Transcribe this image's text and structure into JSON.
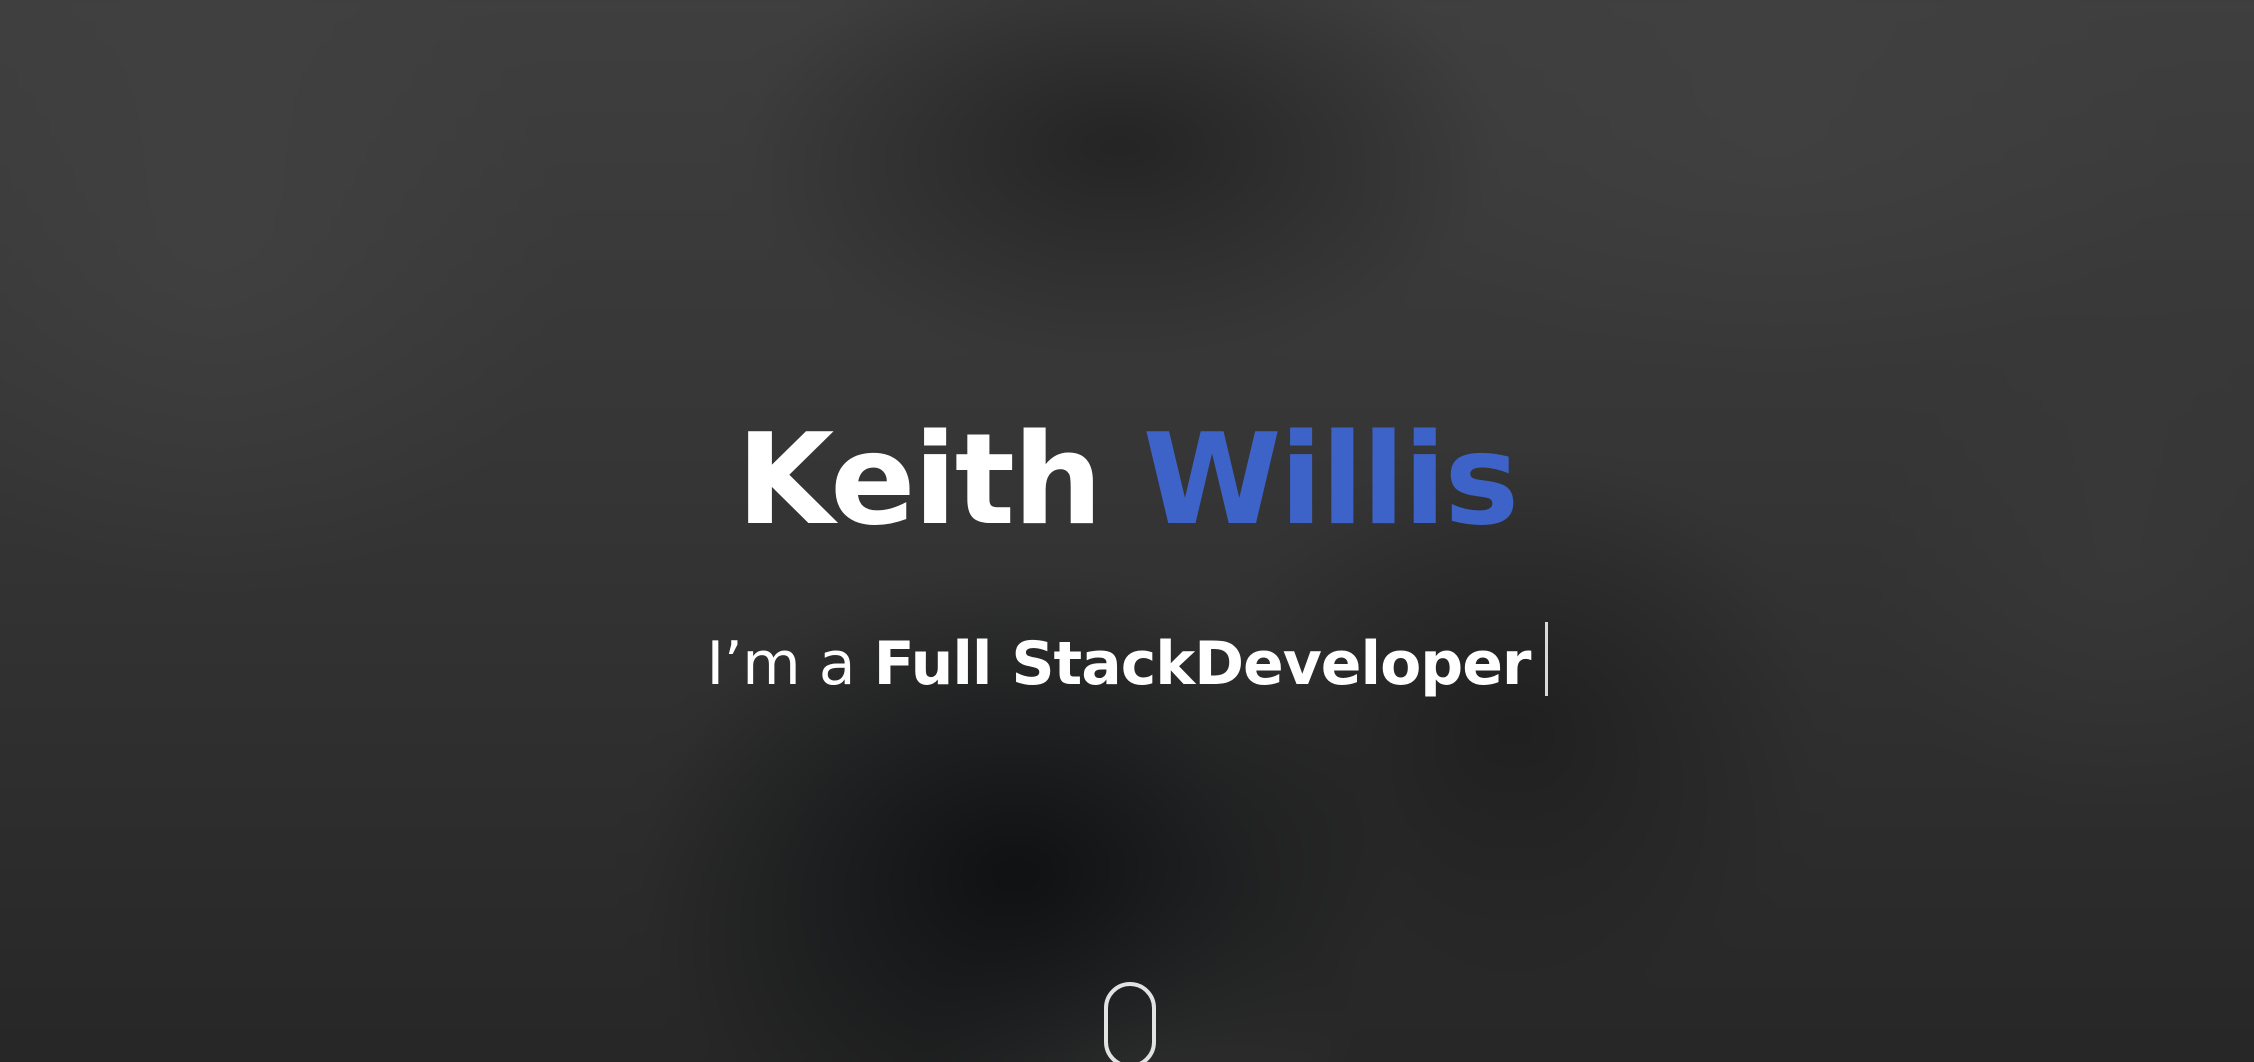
{
  "hero": {
    "first_name": "Keith",
    "last_name": "Willis",
    "intro": "I’m a ",
    "role": "Full StackDeveloper",
    "colors": {
      "title": "#ffffff",
      "accent": "#3d63c9",
      "background": "#2f2f2f"
    },
    "icons": {
      "scroll": "mouse-scroll-icon",
      "cursor": "typing-cursor"
    }
  }
}
